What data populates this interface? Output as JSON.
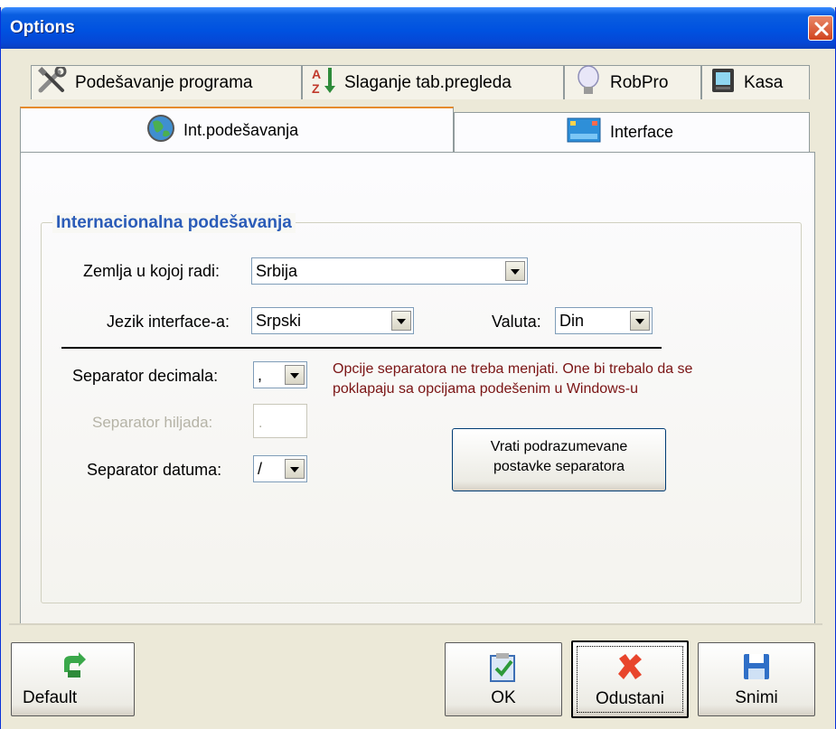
{
  "window": {
    "title": "Options"
  },
  "tabs_row1": [
    {
      "label": "Podešavanje programa",
      "icon": "tools-icon"
    },
    {
      "label": "Slaganje tab.pregleda",
      "icon": "sort-az-icon"
    },
    {
      "label": "RobPro",
      "icon": "lightbulb-icon"
    },
    {
      "label": "Kasa",
      "icon": "cash-register-icon"
    }
  ],
  "tabs_row2": [
    {
      "label": "Int.podešavanja",
      "icon": "globe-icon",
      "active": true
    },
    {
      "label": "Interface",
      "icon": "desktop-icon",
      "active": false
    }
  ],
  "group": {
    "title": "Internacionalna podešavanja"
  },
  "fields": {
    "country": {
      "label": "Zemlja u kojoj radi:",
      "value": "Srbija"
    },
    "language": {
      "label": "Jezik interface-a:",
      "value": "Srpski"
    },
    "currency": {
      "label": "Valuta:",
      "value": "Din"
    },
    "decimal_sep": {
      "label": "Separator decimala:",
      "value": ","
    },
    "thousand_sep": {
      "label": "Separator hiljada:",
      "value": "."
    },
    "date_sep": {
      "label": "Separator datuma:",
      "value": "/"
    }
  },
  "note": "Opcije separatora ne treba menjati. One bi trebalo da se poklapaju sa opcijama podešenim u Windows-u",
  "restore_button": {
    "line1": "Vrati podrazumevane",
    "line2": "postavke separatora"
  },
  "buttons": {
    "default": "Default",
    "ok": "OK",
    "cancel": "Odustani",
    "save": "Snimi"
  },
  "colors": {
    "title_bar": "#0a5ee0",
    "group_title": "#2b5cb8",
    "note_text": "#7a1414",
    "active_tab_accent": "#e68b2c"
  }
}
